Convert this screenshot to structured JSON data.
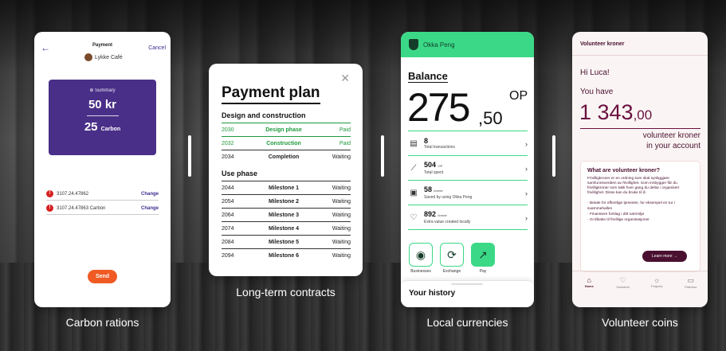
{
  "captions": {
    "carbon": "Carbon rations",
    "contracts": "Long-term contracts",
    "currencies": "Local currencies",
    "volunteer": "Volunteer coins"
  },
  "carbon_card": {
    "back_icon": "arrow-left-icon",
    "header_title": "Payment",
    "merchant": "Lykke Café",
    "cancel_label": "Cancel",
    "summary_label": "⊕ Summary",
    "amount_kr": "50 kr",
    "amount_carbon_num": "25",
    "amount_carbon_unit": "Carbon",
    "accounts": [
      {
        "number": "3107.24.47862",
        "action": "Change"
      },
      {
        "number": "3107.24.47863 Carbon",
        "action": "Change"
      }
    ],
    "send_label": "Send",
    "accent": "#4a2f88",
    "send_color": "#f05a23"
  },
  "plan_card": {
    "title": "Payment plan",
    "section1": "Design and construction",
    "section2": "Use phase",
    "design_rows": [
      {
        "year": "2030",
        "name": "Design phase",
        "status": "Paid"
      },
      {
        "year": "2032",
        "name": "Construction",
        "status": "Paid"
      },
      {
        "year": "2034",
        "name": "Completion",
        "status": "Waiting"
      }
    ],
    "use_rows": [
      {
        "year": "2044",
        "name": "Milestone 1",
        "status": "Waiting"
      },
      {
        "year": "2054",
        "name": "Milestone 2",
        "status": "Waiting"
      },
      {
        "year": "2064",
        "name": "Milestone 3",
        "status": "Waiting"
      },
      {
        "year": "2074",
        "name": "Milestone 4",
        "status": "Waiting"
      },
      {
        "year": "2084",
        "name": "Milestone 5",
        "status": "Waiting"
      },
      {
        "year": "2094",
        "name": "Milestone 6",
        "status": "Waiting"
      }
    ],
    "paid_color": "#1e9a3c"
  },
  "okka_card": {
    "brand": "Okka Peng",
    "balance_label": "Balance",
    "balance_int": "275",
    "balance_dec": ",50",
    "currency": "OP",
    "stats": [
      {
        "icon": "receipt-icon",
        "value": "8",
        "unit": "",
        "label": "Total transactions"
      },
      {
        "icon": "chart-line-icon",
        "value": "504",
        "unit": "OP",
        "label": "Total spent"
      },
      {
        "icon": "wallet-icon",
        "value": "58",
        "unit": "kroner",
        "label": "Saved by using Okka Peng"
      },
      {
        "icon": "heart-icon",
        "value": "892",
        "unit": "kroner",
        "label": "Extra value created locally"
      }
    ],
    "actions": [
      {
        "icon": "location-pin-icon",
        "label": "Businesses"
      },
      {
        "icon": "exchange-icon",
        "label": "Exchange"
      },
      {
        "icon": "arrow-up-right-icon",
        "label": "Pay"
      }
    ],
    "history_label": "Your history",
    "accent": "#3bd987"
  },
  "vk_card": {
    "header": "Volunteer kroner",
    "greeting": "Hi Luca!",
    "you_have": "You have",
    "amount_int": "1 343",
    "amount_dec": ",00",
    "unit_line1": "volunteer kroner",
    "unit_line2": "in your account",
    "info_title": "What are volunteer kroner?",
    "info_text": "Frivilligkroner er en ordning som skal synliggjøre samfunnsverdien av frivillighet. Som innbygger får du frivilligkroner som takk hver gang du deltar i organisert frivillighet. Disse kan du bruke til å:",
    "bullets": [
      "Betale for offentlige tjenester, for eksempel en tur i svømmehallen",
      "Finansiere forslag i ditt nærmiljø",
      "Gi tilbake til frivillige organisasjoner"
    ],
    "learn_more": "Learn more →",
    "nav": [
      {
        "icon": "home-icon",
        "label": "Home"
      },
      {
        "icon": "heart-icon",
        "label": "Volunteer"
      },
      {
        "icon": "bulb-icon",
        "label": "Projects"
      },
      {
        "icon": "card-icon",
        "label": "Partners"
      }
    ],
    "accent": "#4a1030"
  }
}
